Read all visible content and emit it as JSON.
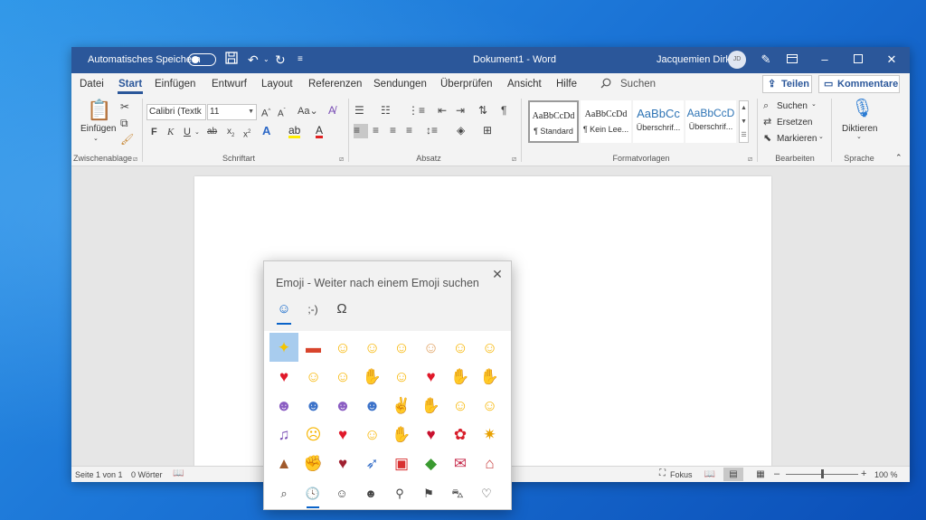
{
  "titlebar": {
    "autosave_label": "Automatisches Speichern",
    "doc_title": "Dokument1  -  Word",
    "user_name": "Jacquemien Dirk",
    "avatar_initials": "JD"
  },
  "tabs": [
    "Datei",
    "Start",
    "Einfügen",
    "Entwurf",
    "Layout",
    "Referenzen",
    "Sendungen",
    "Überprüfen",
    "Ansicht",
    "Hilfe"
  ],
  "search_label": "Suchen",
  "share_label": "Teilen",
  "comment_label": "Kommentare",
  "ribbon": {
    "clipboard": {
      "paste_label": "Einfügen",
      "group_label": "Zwischenablage"
    },
    "font": {
      "font_name": "Calibri (Textk",
      "font_size": "11",
      "group_label": "Schriftart"
    },
    "paragraph": {
      "group_label": "Absatz"
    },
    "styles": {
      "group_label": "Formatvorlagen",
      "items": [
        {
          "sample": "AaBbCcDd",
          "name": "¶ Standard"
        },
        {
          "sample": "AaBbCcDd",
          "name": "¶ Kein Lee..."
        },
        {
          "sample": "AaBbCc",
          "name": "Überschrif..."
        },
        {
          "sample": "AaBbCcD",
          "name": "Überschrif..."
        }
      ]
    },
    "editing": {
      "group_label": "Bearbeiten",
      "find": "Suchen",
      "replace": "Ersetzen",
      "select": "Markieren"
    },
    "voice": {
      "group_label": "Sprache",
      "dictate": "Diktieren"
    }
  },
  "statusbar": {
    "page": "Seite 1 von 1",
    "words": "0 Wörter",
    "focus": "Fokus",
    "zoom": "100 %"
  },
  "emoji_panel": {
    "title": "Emoji - Weiter nach einem Emoji suchen",
    "categories": [
      "smiley-face",
      "kaomoji",
      "omega-symbol"
    ],
    "grid": [
      [
        "sparkles",
        "firecracker",
        "rolling-on-floor-laughing",
        "face-with-tears-of-joy",
        "grinning-squinting-face",
        "man-face",
        "smirking-face",
        "smiling-face"
      ],
      [
        "red-heart",
        "smiling-face-with-heart-eyes",
        "unamused-face",
        "ok-hand",
        "face-blowing-kiss",
        "two-hearts",
        "thumbs-up",
        "raising-hands"
      ],
      [
        "woman-tipping-hand",
        "person-shrugging",
        "woman-shrugging",
        "man-shrugging",
        "victory-hand",
        "crossed-fingers",
        "relieved-face",
        "smiling-face-with-sunglasses"
      ],
      [
        "musical-notes",
        "crying-face",
        "heart-with-ribbon",
        "face-with-tongue",
        "clapping-hands",
        "kiss-mark",
        "rose",
        "party-popper"
      ],
      [
        "birthday-cake",
        "flexed-biceps",
        "heart-on-fire",
        "rocket",
        "wrapped-gift",
        "dragon",
        "love-letter",
        "house"
      ]
    ],
    "footer": [
      "search",
      "recent",
      "smileys",
      "people",
      "celebrations",
      "flags",
      "vehicles",
      "hearts"
    ]
  }
}
